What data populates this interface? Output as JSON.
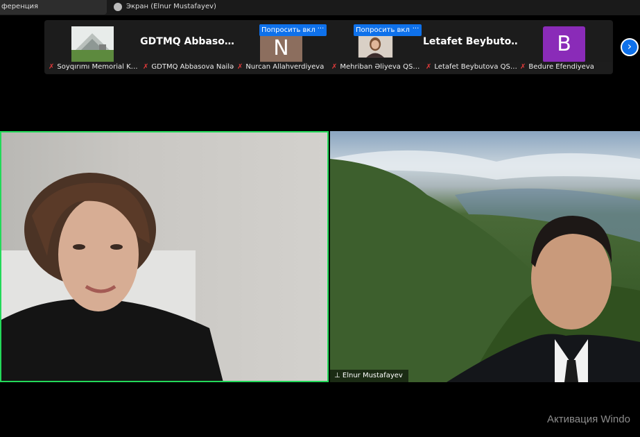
{
  "tabs": {
    "conference_partial": "ференция",
    "screen_label": "Экран (Elnur Mustafayev)"
  },
  "strip": {
    "ask_label": "Попросить вкл",
    "more_label": "···",
    "next_icon": "chevron-right-icon",
    "tiles": [
      {
        "caption": "Soyqırımı Memorial K…",
        "big_name": ""
      },
      {
        "caption": "GDTMQ Abbasova Nailə",
        "big_name": "GDTMQ  Abbaso…"
      },
      {
        "caption": "Nurcan Allahverdiyeva",
        "big_name": "",
        "avatar_letter": "N",
        "avatar_color": "#8c6e5e"
      },
      {
        "caption": "Mehriban Əliyeva QS…",
        "big_name": ""
      },
      {
        "caption": "Letafet Beybutova QS…",
        "big_name": "Letafet  Beybuto…"
      },
      {
        "caption": "Bedure Efendiyeva",
        "big_name": "",
        "avatar_letter": "B",
        "avatar_color": "#8a2bb8"
      }
    ]
  },
  "videos": {
    "right_name": "Elnur Mustafayev",
    "active_speaker_color": "#23d959"
  },
  "watermark": "Активация Windo"
}
